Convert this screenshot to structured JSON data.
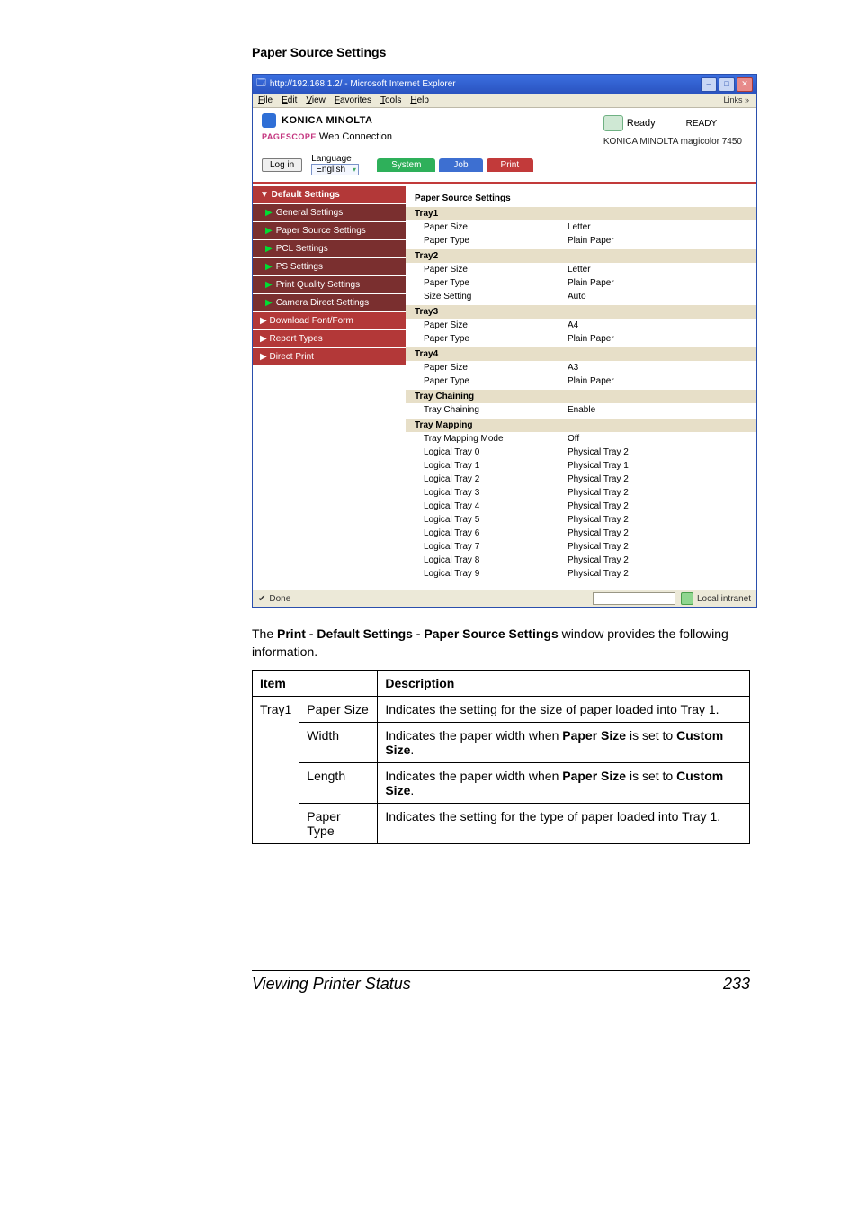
{
  "section_heading": "Paper Source Settings",
  "ie": {
    "title": "http://192.168.1.2/ - Microsoft Internet Explorer",
    "menus": [
      "File",
      "Edit",
      "View",
      "Favorites",
      "Tools",
      "Help"
    ],
    "links_label": "Links",
    "brand": "KONICA MINOLTA",
    "pagescope_prefix": "PAGESCOPE",
    "pagescope_main": "Web Connection",
    "status_ready": "Ready",
    "status_big": "READY",
    "model": "KONICA MINOLTA magicolor 7450",
    "login_btn": "Log in",
    "language_label": "Language",
    "language_value": "English",
    "tabs": {
      "system": "System",
      "job": "Job",
      "print": "Print"
    },
    "sidebar": [
      {
        "cls": "lvl0",
        "label": "▼ Default Settings"
      },
      {
        "cls": "lvl1",
        "label": "General Settings"
      },
      {
        "cls": "lvl1",
        "label": "Paper Source Settings"
      },
      {
        "cls": "lvl1",
        "label": "PCL Settings"
      },
      {
        "cls": "lvl1",
        "label": "PS Settings"
      },
      {
        "cls": "lvl1",
        "label": "Print Quality Settings"
      },
      {
        "cls": "lvl1",
        "label": "Camera Direct Settings"
      },
      {
        "cls": "lvl0b",
        "label": "▶ Download Font/Form"
      },
      {
        "cls": "lvl0b",
        "label": "▶ Report Types"
      },
      {
        "cls": "lvl0b",
        "label": "▶ Direct Print"
      }
    ],
    "main_title": "Paper Source Settings",
    "groups": [
      {
        "name": "Tray1",
        "rows": [
          {
            "k": "Paper Size",
            "v": "Letter"
          },
          {
            "k": "Paper Type",
            "v": "Plain Paper"
          }
        ]
      },
      {
        "name": "Tray2",
        "rows": [
          {
            "k": "Paper Size",
            "v": "Letter"
          },
          {
            "k": "Paper Type",
            "v": "Plain Paper"
          },
          {
            "k": "Size Setting",
            "v": "Auto"
          }
        ]
      },
      {
        "name": "Tray3",
        "rows": [
          {
            "k": "Paper Size",
            "v": "A4"
          },
          {
            "k": "Paper Type",
            "v": "Plain Paper"
          }
        ]
      },
      {
        "name": "Tray4",
        "rows": [
          {
            "k": "Paper Size",
            "v": "A3"
          },
          {
            "k": "Paper Type",
            "v": "Plain Paper"
          }
        ]
      },
      {
        "name": "Tray Chaining",
        "rows": [
          {
            "k": "Tray Chaining",
            "v": "Enable"
          }
        ]
      },
      {
        "name": "Tray Mapping",
        "rows": [
          {
            "k": "Tray Mapping Mode",
            "v": "Off"
          },
          {
            "k": "Logical Tray 0",
            "v": "Physical Tray 2"
          },
          {
            "k": "Logical Tray 1",
            "v": "Physical Tray 1"
          },
          {
            "k": "Logical Tray 2",
            "v": "Physical Tray 2"
          },
          {
            "k": "Logical Tray 3",
            "v": "Physical Tray 2"
          },
          {
            "k": "Logical Tray 4",
            "v": "Physical Tray 2"
          },
          {
            "k": "Logical Tray 5",
            "v": "Physical Tray 2"
          },
          {
            "k": "Logical Tray 6",
            "v": "Physical Tray 2"
          },
          {
            "k": "Logical Tray 7",
            "v": "Physical Tray 2"
          },
          {
            "k": "Logical Tray 8",
            "v": "Physical Tray 2"
          },
          {
            "k": "Logical Tray 9",
            "v": "Physical Tray 2"
          }
        ]
      }
    ],
    "status_done": "Done",
    "status_zone": "Local intranet"
  },
  "para_pre": "The ",
  "para_bold": "Print - Default Settings - Paper Source Settings",
  "para_post": " window provides the following information.",
  "table": {
    "h_item": "Item",
    "h_desc": "Description",
    "r1c1": "Tray1",
    "rows": [
      {
        "c2": "Paper Size",
        "c3": "Indicates the setting for the size of paper loaded into Tray 1."
      },
      {
        "c2": "Width",
        "c3_pre": "Indicates the paper width when ",
        "c3_b1": "Paper Size",
        "c3_mid": " is set to ",
        "c3_b2": "Custom Size",
        "c3_post": "."
      },
      {
        "c2": "Length",
        "c3_pre": "Indicates the paper width when ",
        "c3_b1": "Paper Size",
        "c3_mid": " is set to ",
        "c3_b2": "Custom Size",
        "c3_post": "."
      },
      {
        "c2": "Paper Type",
        "c3": "Indicates the setting for the type of paper loaded into Tray 1."
      }
    ]
  },
  "footer": {
    "title": "Viewing Printer Status",
    "page": "233"
  }
}
